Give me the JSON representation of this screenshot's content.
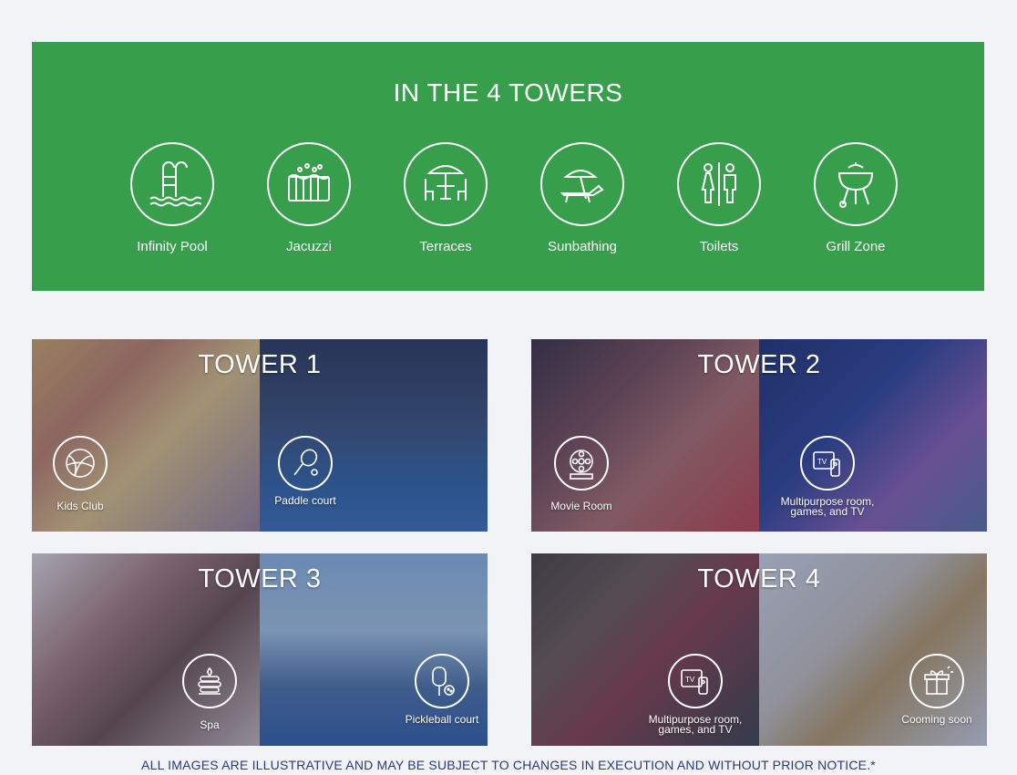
{
  "banner": {
    "title": "IN THE 4 TOWERS",
    "amenities": [
      {
        "label": "Infinity Pool",
        "icon": "pool-ladder-icon"
      },
      {
        "label": "Jacuzzi",
        "icon": "jacuzzi-icon"
      },
      {
        "label": "Terraces",
        "icon": "terrace-table-icon"
      },
      {
        "label": "Sunbathing",
        "icon": "sunbed-umbrella-icon"
      },
      {
        "label": "Toilets",
        "icon": "toilets-icon"
      },
      {
        "label": "Grill Zone",
        "icon": "grill-icon"
      }
    ]
  },
  "towers": [
    {
      "title": "TOWER 1",
      "items": [
        {
          "label": "Kids Club",
          "icon": "beach-ball-icon"
        },
        {
          "label": "Paddle court",
          "icon": "paddle-racket-icon"
        }
      ]
    },
    {
      "title": "TOWER 2",
      "items": [
        {
          "label": "Movie Room",
          "icon": "film-reel-icon"
        },
        {
          "label": "Multipurpose room, games, and TV",
          "icon": "tv-remote-icon"
        }
      ]
    },
    {
      "title": "TOWER 3",
      "items": [
        {
          "label": "Spa",
          "icon": "spa-stones-icon"
        },
        {
          "label": "Pickleball court",
          "icon": "pickleball-paddle-icon"
        }
      ]
    },
    {
      "title": "TOWER 4",
      "items": [
        {
          "label": "Multipurpose room, games, and TV",
          "icon": "tv-remote-icon"
        },
        {
          "label": "Cooming soon",
          "icon": "gift-icon"
        }
      ]
    }
  ],
  "footer": {
    "note": "ALL IMAGES ARE ILLUSTRATIVE AND MAY BE SUBJECT TO CHANGES IN EXECUTION AND WITHOUT PRIOR NOTICE.*"
  },
  "colors": {
    "banner_green": "#379e4c",
    "footer_text": "#2b3a7a",
    "page_background": "#f1f3f6"
  }
}
